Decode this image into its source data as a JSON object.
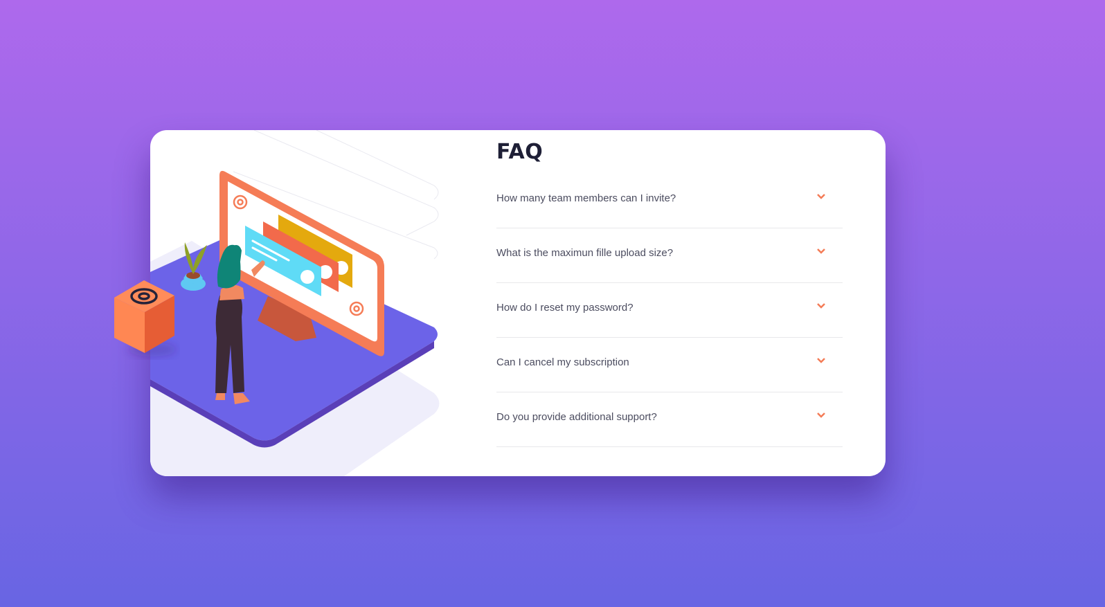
{
  "faq": {
    "title": "FAQ",
    "items": [
      {
        "question": "How many team members can I invite?"
      },
      {
        "question": "What is the maximun fille upload size?"
      },
      {
        "question": "How do I reset my password?"
      },
      {
        "question": "Can I cancel my subscription"
      },
      {
        "question": "Do you provide additional support?"
      }
    ]
  },
  "icons": {
    "toggle": "chevron-down-icon",
    "illustration": "woman-online-desktop-illustration",
    "box": "at-sign-box-illustration"
  },
  "colors": {
    "background_top": "#ae69ec",
    "background_bottom": "#6865e3",
    "card": "#ffffff",
    "title": "#1e1f36",
    "question": "#4b4c5f",
    "accent": "#f47c57",
    "divider": "#e8e8ea"
  }
}
